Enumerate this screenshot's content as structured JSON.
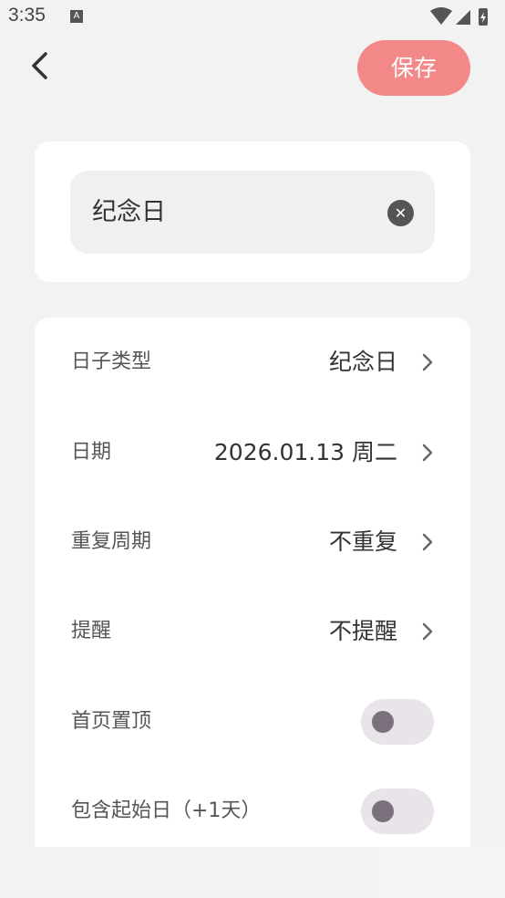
{
  "status_bar": {
    "time": "3:35",
    "notification_icon": "A"
  },
  "header": {
    "back_icon": "chevron-left-icon",
    "save_label": "保存",
    "save_color": "#f38888"
  },
  "title_card": {
    "title_value": "纪念日",
    "clear_icon": "clear-icon"
  },
  "settings": {
    "rows": [
      {
        "label": "日子类型",
        "value": "纪念日"
      },
      {
        "label": "日期",
        "value": "2026.01.13 周二"
      },
      {
        "label": "重复周期",
        "value": "不重复"
      },
      {
        "label": "提醒",
        "value": "不提醒"
      },
      {
        "label": "首页置顶",
        "toggle": false
      },
      {
        "label": "包含起始日（+1天）",
        "toggle": false
      }
    ]
  }
}
